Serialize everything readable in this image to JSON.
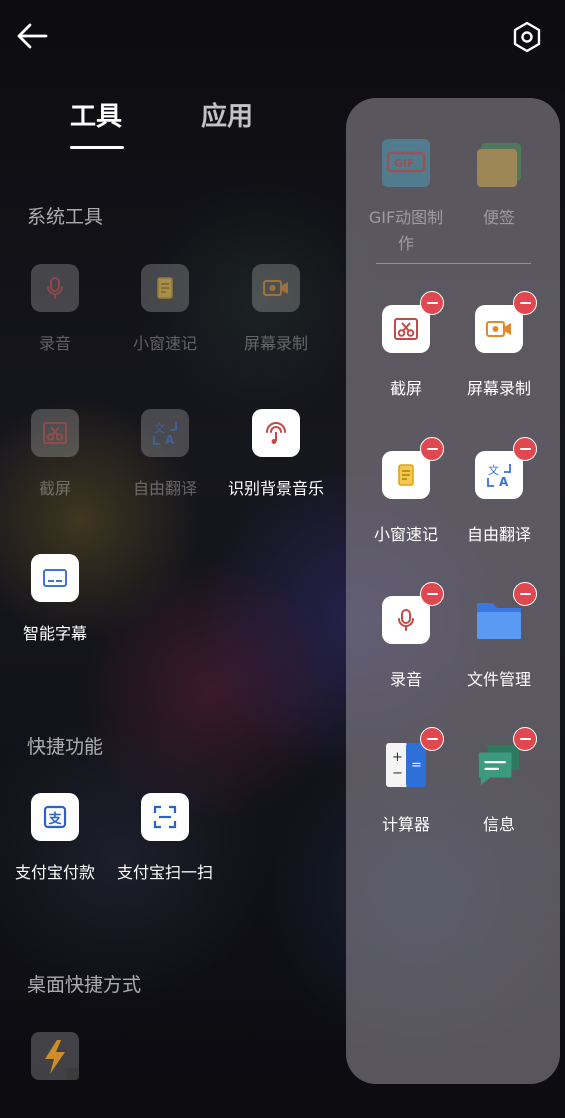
{
  "header": {
    "back_icon": "arrow-left-icon",
    "settings_icon": "gear-hexagon-icon"
  },
  "tabs": [
    {
      "label": "工具",
      "active": true
    },
    {
      "label": "应用",
      "active": false
    }
  ],
  "sections": {
    "system_tools": {
      "title": "系统工具",
      "items": [
        {
          "label": "录音",
          "icon": "microphone-icon",
          "added": true
        },
        {
          "label": "小窗速记",
          "icon": "note-icon",
          "added": true
        },
        {
          "label": "屏幕录制",
          "icon": "screen-record-icon",
          "added": true
        },
        {
          "label": "截屏",
          "icon": "scissors-icon",
          "added": true
        },
        {
          "label": "自由翻译",
          "icon": "translate-icon",
          "added": true
        },
        {
          "label": "识别背景音乐",
          "icon": "music-recognize-icon",
          "added": false
        },
        {
          "label": "智能字幕",
          "icon": "subtitle-icon",
          "added": false
        }
      ]
    },
    "quick_functions": {
      "title": "快捷功能",
      "items": [
        {
          "label": "支付宝付款",
          "icon": "alipay-pay-icon"
        },
        {
          "label": "支付宝扫一扫",
          "icon": "scan-icon"
        }
      ]
    },
    "desktop_shortcuts": {
      "title": "桌面快捷方式",
      "items": [
        {
          "label": "",
          "icon": "lightning-shortcut-icon"
        }
      ]
    }
  },
  "panel": {
    "faded_items": [
      {
        "label": "GIF动图制作",
        "icon": "gif-icon",
        "icon_text": "GIF"
      },
      {
        "label": "便签",
        "icon": "sticky-note-icon"
      }
    ],
    "items": [
      {
        "label": "截屏",
        "icon": "scissors-icon"
      },
      {
        "label": "屏幕录制",
        "icon": "screen-record-icon"
      },
      {
        "label": "小窗速记",
        "icon": "note-icon"
      },
      {
        "label": "自由翻译",
        "icon": "translate-icon"
      },
      {
        "label": "录音",
        "icon": "microphone-icon"
      },
      {
        "label": "文件管理",
        "icon": "folder-icon"
      },
      {
        "label": "计算器",
        "icon": "calculator-icon"
      },
      {
        "label": "信息",
        "icon": "message-icon"
      }
    ]
  },
  "colors": {
    "remove_badge": "#e0474f",
    "icon_red": "#c44a4a",
    "icon_orange": "#e08a2b",
    "icon_yellow": "#d9a21b",
    "icon_blue": "#3b73d6",
    "folder_blue": "#4a8af0",
    "message_green": "#3e9a7c"
  }
}
